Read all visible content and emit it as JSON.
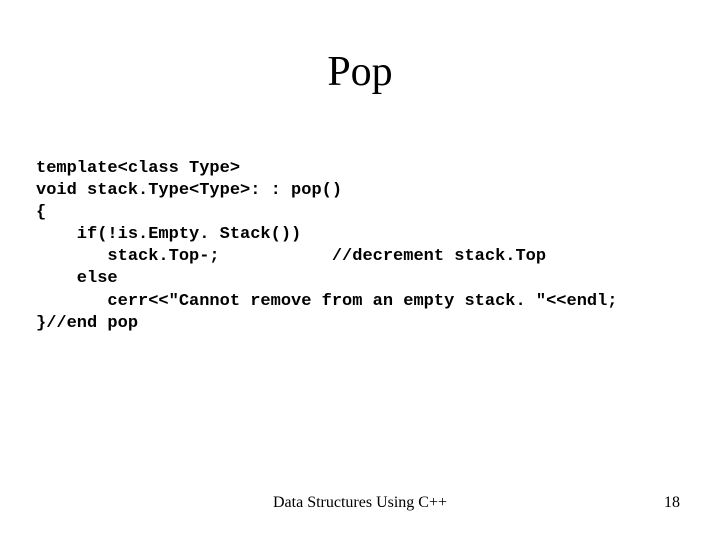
{
  "slide": {
    "title": "Pop",
    "code": "template<class Type>\nvoid stack.Type<Type>: : pop()\n{\n    if(!is.Empty. Stack())\n       stack.Top-;           //decrement stack.Top\n    else\n       cerr<<\"Cannot remove from an empty stack. \"<<endl;\n}//end pop",
    "footer_center": "Data Structures Using C++",
    "page_number": "18"
  }
}
